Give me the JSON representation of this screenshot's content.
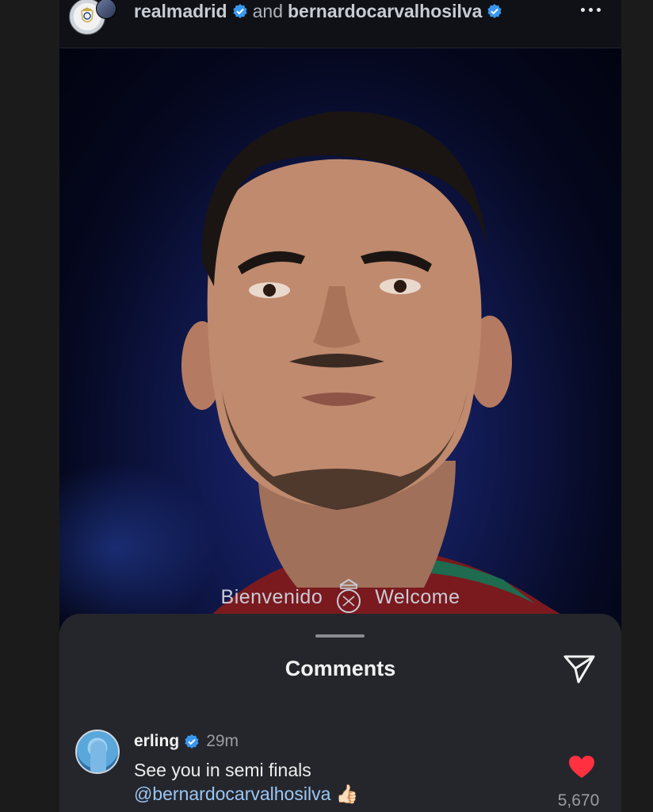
{
  "header": {
    "user1": "realmadrid",
    "connector": "and",
    "user2": "bernardocarvalhosilva"
  },
  "post": {
    "overlay_left": "Bienvenido",
    "overlay_right": "Welcome"
  },
  "comments_sheet": {
    "title": "Comments",
    "comment": {
      "username": "erling",
      "time": "29m",
      "text": "See you in semi finals",
      "mention": "@bernardocarvalhosilva",
      "emoji": "👍🏻",
      "likes": "5,670"
    }
  },
  "colors": {
    "verified": "#3897f0",
    "like": "#ff3040",
    "mention": "#9ac6f5"
  },
  "icons": [
    "more-icon",
    "verified-icon",
    "share-icon",
    "heart-icon",
    "crest-icon"
  ]
}
